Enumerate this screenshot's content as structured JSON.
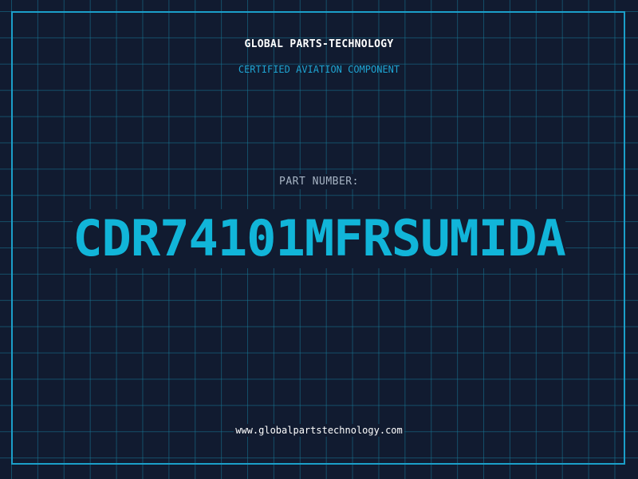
{
  "header": {
    "company": "GLOBAL PARTS-TECHNOLOGY",
    "tagline": "CERTIFIED AVIATION COMPONENT"
  },
  "part": {
    "label": "PART NUMBER:",
    "number": "CDR74101MFRSUMIDA"
  },
  "footer": {
    "website": "www.globalpartstechnology.com"
  },
  "colors": {
    "background": "#111b30",
    "grid": "#1778a0",
    "accent": "#11b5d9",
    "frame": "#1b9fc9"
  }
}
